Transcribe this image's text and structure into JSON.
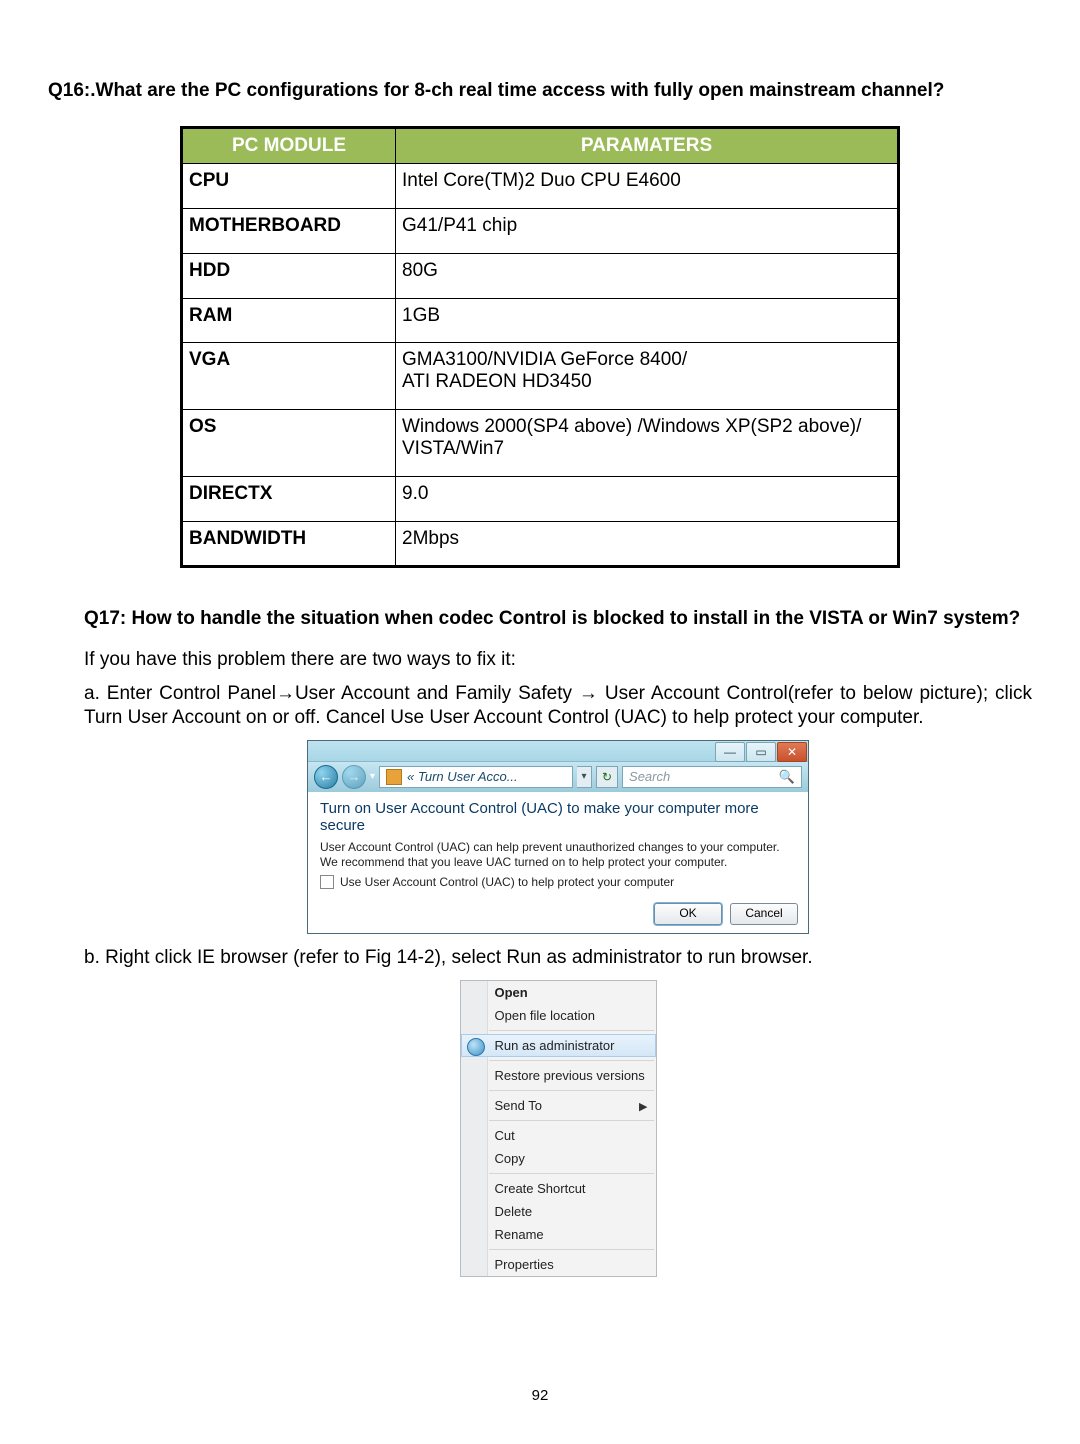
{
  "q16": "Q16:.What are the PC configurations for 8-ch real time access with fully open mainstream channel?",
  "table": {
    "head_module": "PC MODULE",
    "head_params": "PARAMATERS",
    "rows": [
      {
        "k": "CPU",
        "v": "Intel Core(TM)2 Duo CPU E4600"
      },
      {
        "k": "MOTHERBOARD",
        "v": "G41/P41 chip"
      },
      {
        "k": "HDD",
        "v": "80G"
      },
      {
        "k": "RAM",
        "v": "1GB"
      },
      {
        "k": "VGA",
        "v": "GMA3100/NVIDIA GeForce 8400/\nATI RADEON HD3450"
      },
      {
        "k": "OS",
        "v": "Windows 2000(SP4 above) /Windows XP(SP2 above)/ VISTA/Win7"
      },
      {
        "k": "DIRECTX",
        "v": "9.0"
      },
      {
        "k": "BANDWIDTH",
        "v": "2Mbps"
      }
    ]
  },
  "q17": "Q17: How to handle the situation when codec Control is blocked to install in the VISTA or Win7 system?",
  "q17_intro": "If you have this problem there are two ways to fix it:",
  "q17_a": "a. Enter Control Panel→User Account and Family Safety → User Account Control(refer to below picture); click Turn User Account on or off. Cancel Use User Account Control (UAC) to help protect your computer.",
  "q17_b": "b. Right click IE browser (refer to Fig 14-2), select Run as administrator to run browser.",
  "uac": {
    "breadcrumb": "«  Turn User Acco...",
    "search_placeholder": "Search",
    "heading": "Turn on User Account Control (UAC) to make your computer more secure",
    "body": "User Account Control (UAC) can help prevent unauthorized changes to your computer.  We recommend that you leave UAC turned on to help protect your computer.",
    "checkbox": "Use User Account Control (UAC) to help protect your computer",
    "ok": "OK",
    "cancel": "Cancel"
  },
  "ctx": {
    "open": "Open",
    "open_loc": "Open file location",
    "run_admin": "Run as administrator",
    "restore": "Restore previous versions",
    "send_to": "Send To",
    "cut": "Cut",
    "copy": "Copy",
    "create_shortcut": "Create Shortcut",
    "delete": "Delete",
    "rename": "Rename",
    "properties": "Properties"
  },
  "page_number": "92"
}
